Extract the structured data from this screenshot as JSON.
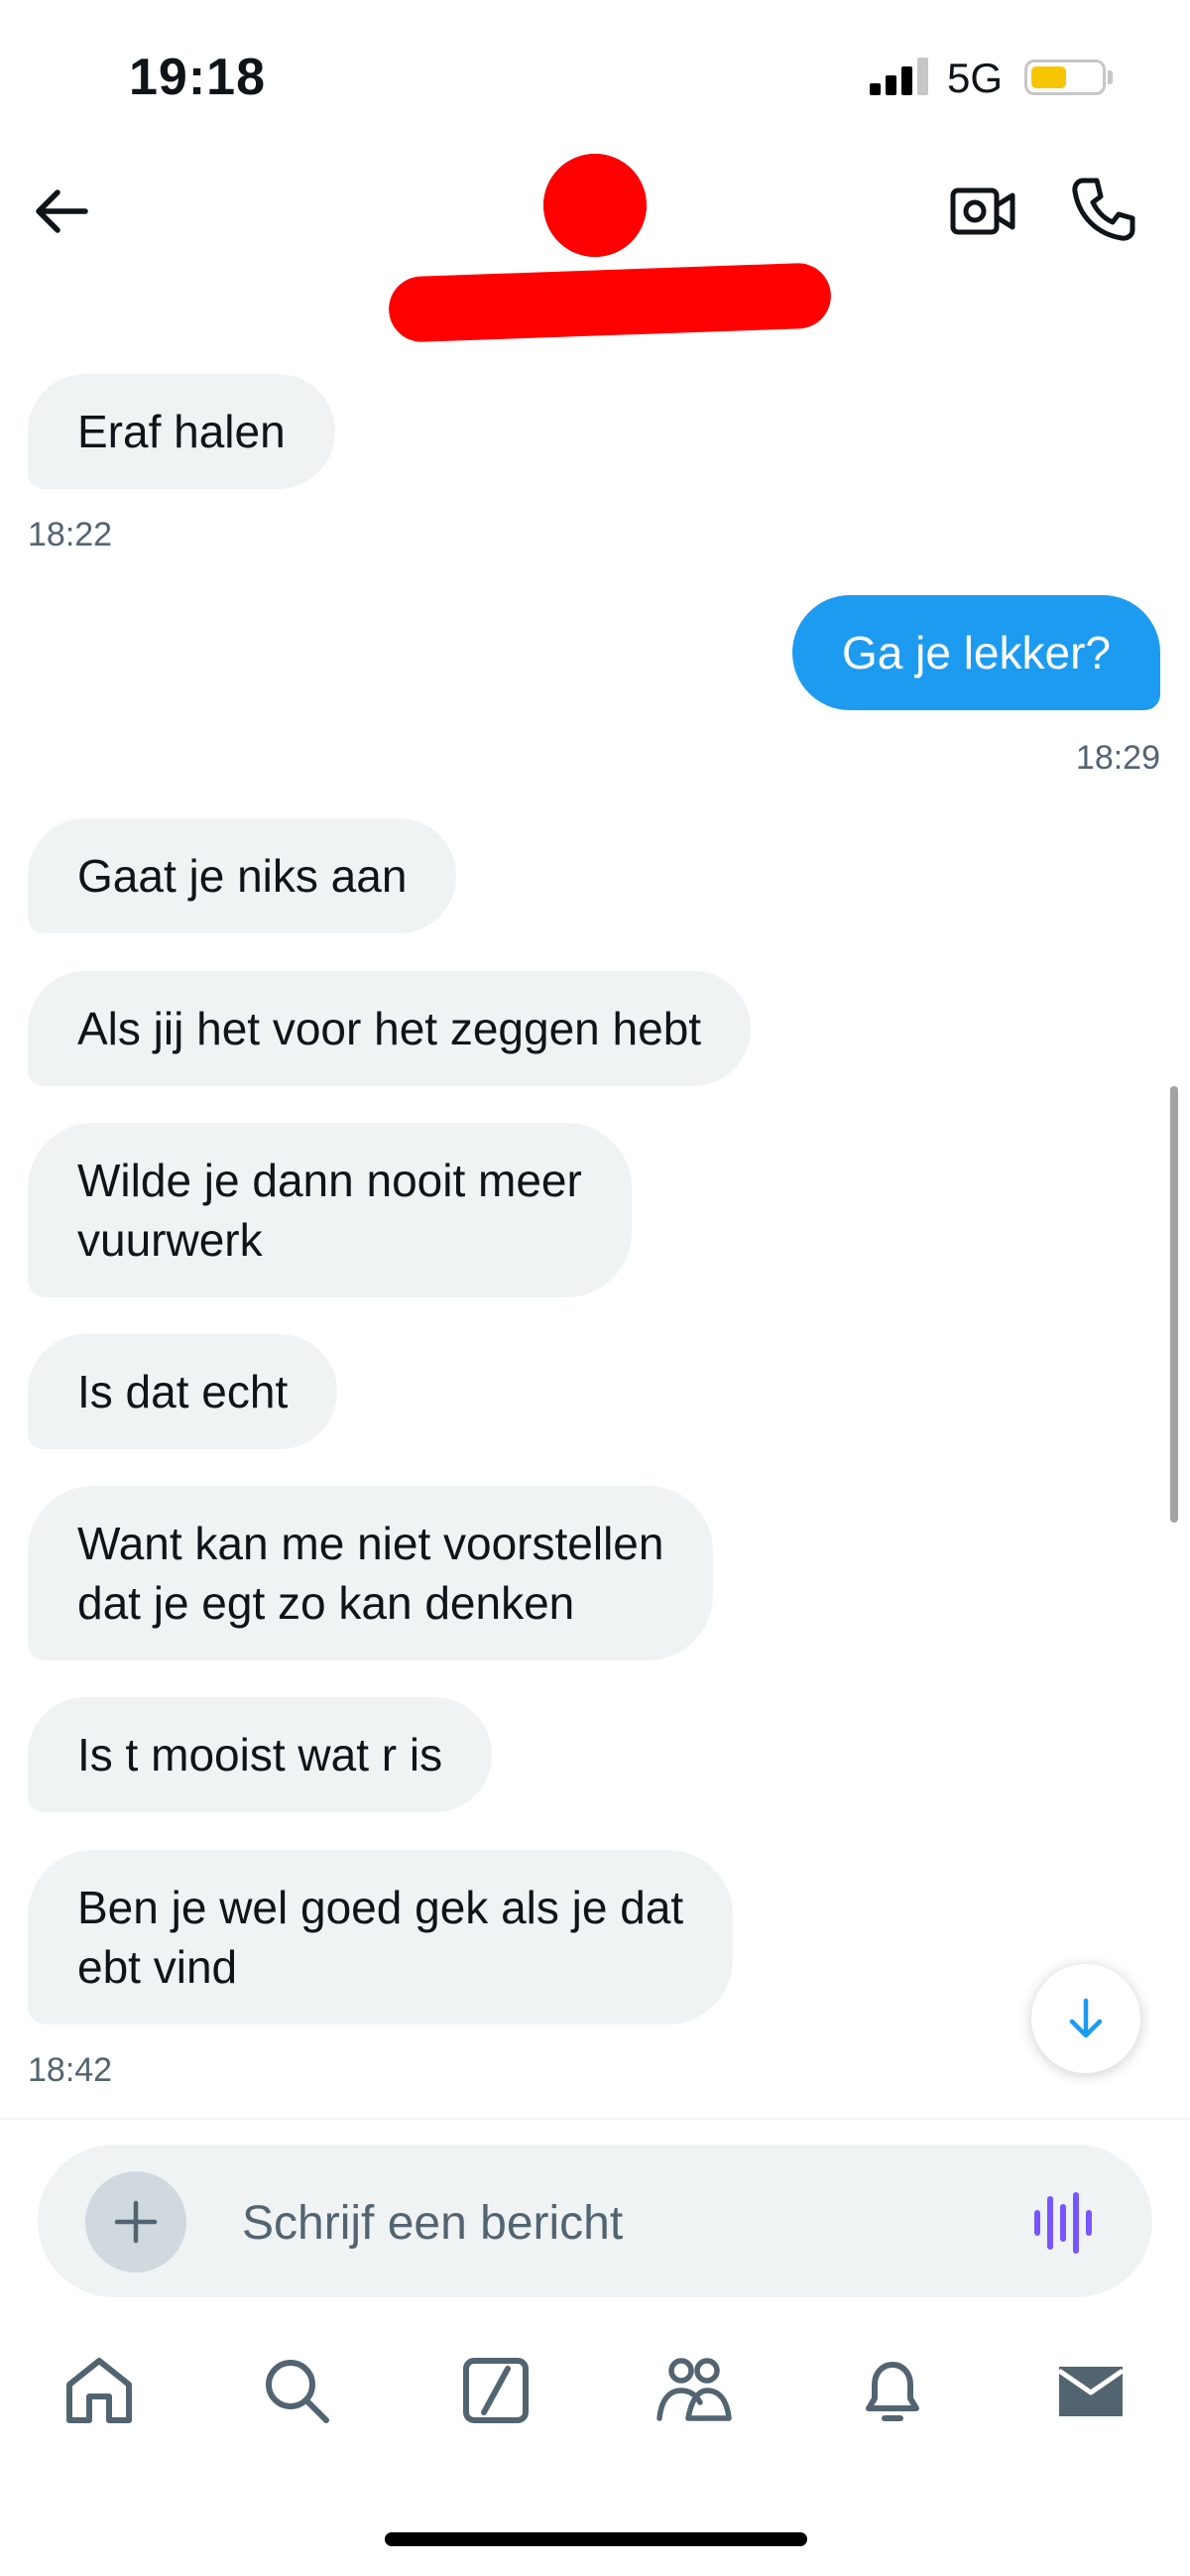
{
  "status_bar": {
    "time": "19:18",
    "network": "5G",
    "battery_level": 0.5
  },
  "header": {
    "back_icon": "arrow-left-icon",
    "video_icon": "video-camera-icon",
    "call_icon": "phone-icon"
  },
  "messages": [
    {
      "direction": "in",
      "text": "Eraf halen"
    },
    {
      "timestamp": "18:22"
    },
    {
      "direction": "out",
      "text": "Ga je lekker?"
    },
    {
      "timestamp": "18:29"
    },
    {
      "direction": "in",
      "text": "Gaat je niks aan"
    },
    {
      "direction": "in",
      "text": "Als jij het voor het zeggen hebt"
    },
    {
      "direction": "in",
      "text": "Wilde je dann nooit meer\nvuurwerk"
    },
    {
      "direction": "in",
      "text": "Is dat echt"
    },
    {
      "direction": "in",
      "text": "Want kan me niet voorstellen\ndat je egt zo kan denken"
    },
    {
      "direction": "in",
      "text": "Is t mooist wat r is"
    },
    {
      "direction": "in",
      "text": "Ben je wel goed gek als je dat\nebt vind"
    },
    {
      "timestamp": "18:42"
    }
  ],
  "composer": {
    "placeholder": "Schrijf een bericht",
    "value": ""
  },
  "tabs": [
    "home-icon",
    "search-icon",
    "grok-icon",
    "communities-icon",
    "notifications-icon",
    "messages-icon"
  ],
  "colors": {
    "accent": "#1d9bf0",
    "bubble_in": "#eff3f4",
    "voice": "#7856ff",
    "redaction": "#ff0000"
  }
}
